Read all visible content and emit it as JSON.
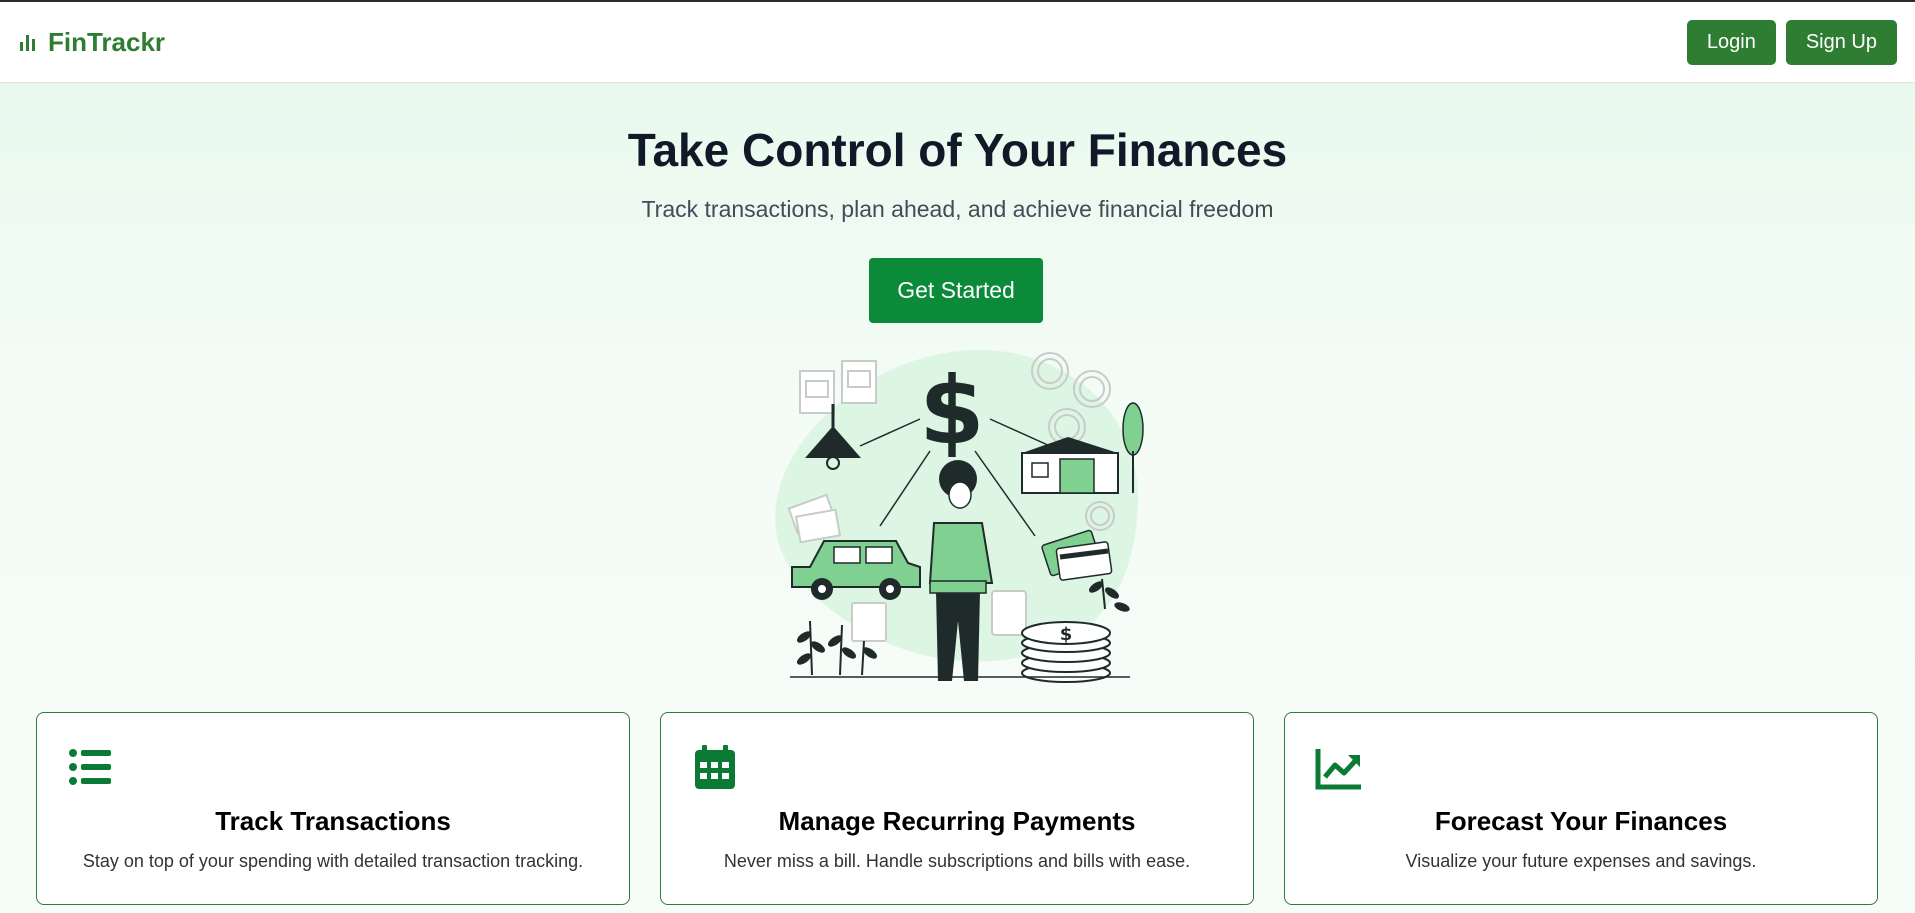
{
  "brand": {
    "name": "FinTrackr",
    "icon": "bar-chart-icon"
  },
  "nav": {
    "login_label": "Login",
    "signup_label": "Sign Up"
  },
  "hero": {
    "title": "Take Control of Your Finances",
    "subtitle": "Track transactions, plan ahead, and achieve financial freedom",
    "cta_label": "Get Started",
    "illustration": "finance-illustration"
  },
  "features": [
    {
      "icon": "list-icon",
      "title": "Track Transactions",
      "description": "Stay on top of your spending with detailed transaction tracking."
    },
    {
      "icon": "calendar-icon",
      "title": "Manage Recurring Payments",
      "description": "Never miss a bill. Handle subscriptions and bills with ease."
    },
    {
      "icon": "trend-chart-icon",
      "title": "Forecast Your Finances",
      "description": "Visualize your future expenses and savings."
    }
  ],
  "colors": {
    "brand": "#2e7d32",
    "cta": "#0b8a3a",
    "background": "#f3fcf5"
  }
}
